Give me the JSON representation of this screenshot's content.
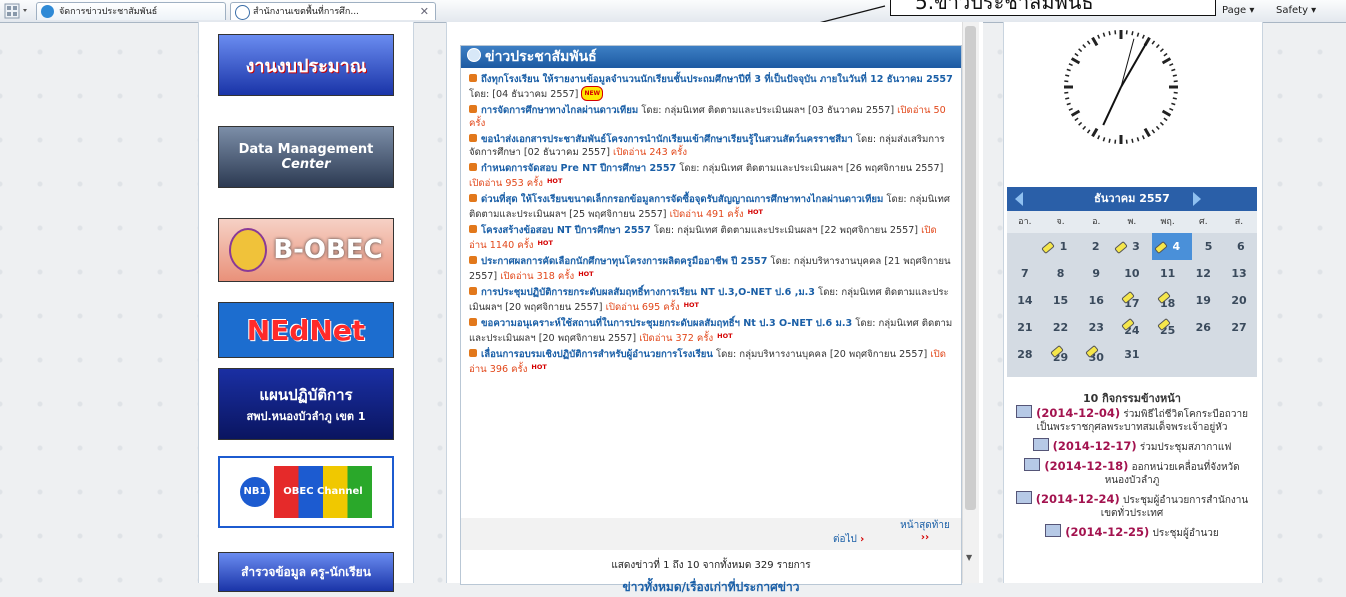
{
  "browser": {
    "tabs": [
      {
        "label": "จัดการข่าวประชาสัมพันธ์",
        "active": false
      },
      {
        "label": "สำนักงานเขตพื้นที่การศึก...",
        "active": true
      }
    ],
    "close_symbol": "✕",
    "commands": {
      "page": "Page ▾",
      "safety": "Safety ▾"
    },
    "icons": [
      "tab-grid-icon",
      "ie-icon",
      "close-icon"
    ]
  },
  "callout": {
    "text": "5.ข่าวประชาสัมพันธ์"
  },
  "left_banners": [
    {
      "label": "งานงบประมาณ"
    },
    {
      "label": "Data Management",
      "sub": "Center"
    },
    {
      "label": "B-OBEC"
    },
    {
      "label": "NEdNet"
    },
    {
      "label": "แผนปฏิบัติการ",
      "sub": "สพป.หนองบัวลำภู เขต 1"
    },
    {
      "label": "NB1",
      "sub": "OBEC Channel"
    },
    {
      "label": "สำรวจข้อมูล ครู-นักเรียน"
    }
  ],
  "news": {
    "header": "ข่าวประชาสัมพันธ์",
    "items": [
      {
        "title": "ถึงทุกโรงเรียน ให้รายงานข้อมูลจำนวนนักเรียนชั้นประถมศึกษาปีที่ 3 ที่เป็นปัจจุบัน ภายในวันที่ 12 ธันวาคม 2557",
        "meta": " โดย: [04 ธันวาคม 2557]",
        "read": "",
        "hot": "",
        "new": "NEW"
      },
      {
        "title": "การจัดการศึกษาทางไกลผ่านดาวเทียม",
        "meta": " โดย: กลุ่มนิเทศ ติดตามและประเมินผลฯ [03 ธันวาคม 2557] ",
        "read": "เปิดอ่าน 50 ครั้ง",
        "hot": "",
        "new": ""
      },
      {
        "title": "ขอนำส่งเอกสารประชาสัมพันธ์โครงการนำนักเรียนเข้าศึกษาเรียนรู้ในสวนสัตว์นครราชสีมา",
        "meta": " โดย: กลุ่มส่งเสริมการจัดการศึกษา [02 ธันวาคม 2557] ",
        "read": "เปิดอ่าน 243 ครั้ง",
        "hot": "",
        "new": ""
      },
      {
        "title": "กำหนดการจัดสอบ Pre NT ปีการศึกษา 2557",
        "meta": " โดย: กลุ่มนิเทศ ติดตามและประเมินผลฯ [26 พฤศจิกายน 2557] ",
        "read": "เปิดอ่าน 953 ครั้ง",
        "hot": "HOT",
        "new": ""
      },
      {
        "title": "ด่วนที่สุด ให้โรงเรียนขนาดเล็กกรอกข้อมูลการจัดซื้อจุดรับสัญญาณการศึกษาทางไกลผ่านดาวเทียม",
        "meta": " โดย: กลุ่มนิเทศ ติดตามและประเมินผลฯ [25 พฤศจิกายน 2557] ",
        "read": "เปิดอ่าน 491 ครั้ง",
        "hot": "HOT",
        "new": ""
      },
      {
        "title": "โครงสร้างข้อสอบ NT ปีการศึกษา 2557",
        "meta": " โดย: กลุ่มนิเทศ ติดตามและประเมินผลฯ [22 พฤศจิกายน 2557] ",
        "read": "เปิดอ่าน 1140 ครั้ง",
        "hot": "HOT",
        "new": ""
      },
      {
        "title": "ประกาศผลการคัดเลือกนักศึกษาทุนโครงการผลิตครูมืออาชีพ ปี 2557",
        "meta": " โดย: กลุ่มบริหารงานบุคคล [21 พฤศจิกายน 2557] ",
        "read": "เปิดอ่าน 318 ครั้ง",
        "hot": "HOT",
        "new": ""
      },
      {
        "title": "การประชุมปฏิบัติการยกระดับผลสัมฤทธิ์ทางการเรียน NT ป.3,O-NET ป.6 ,ม.3",
        "meta": " โดย: กลุ่มนิเทศ ติดตามและประเมินผลฯ [20 พฤศจิกายน 2557] ",
        "read": "เปิดอ่าน 695 ครั้ง",
        "hot": "HOT",
        "new": ""
      },
      {
        "title": "ขอความอนุเคราะห์ใช้สถานที่ในการประชุมยกระดับผลสัมฤทธิ์ฯ Nt ป.3 O-NET ป.6 ม.3",
        "meta": " โดย: กลุ่มนิเทศ ติดตามและประเมินผลฯ [20 พฤศจิกายน 2557] ",
        "read": "เปิดอ่าน 372 ครั้ง",
        "hot": "HOT",
        "new": ""
      },
      {
        "title": "เลื่อนการอบรมเชิงปฏิบัติการสำหรับผู้อำนวยการโรงเรียน",
        "meta": " โดย: กลุ่มบริหารงานบุคคล [20 พฤศจิกายน 2557] ",
        "read": "เปิดอ่าน 396 ครั้ง",
        "hot": "HOT",
        "new": ""
      }
    ],
    "pager": {
      "next": "ต่อไป",
      "next_arrow": "›",
      "last": "หน้าสุดท้าย",
      "last_arrow": "››"
    },
    "summary": "แสดงข่าวที่ 1 ถึง 10 จากทั้งหมด 329 รายการ",
    "all_link": "ข่าวทั้งหมด/เรื่องเก่าที่ประกาศข่าว"
  },
  "calendar": {
    "month": "ธันวาคม 2557",
    "dow": [
      "อา.",
      "จ.",
      "อ.",
      "พ.",
      "พฤ.",
      "ศ.",
      "ส."
    ],
    "weeks": [
      [
        "",
        "1",
        "2",
        "3",
        "4",
        "5",
        "6"
      ],
      [
        "7",
        "8",
        "9",
        "10",
        "11",
        "12",
        "13"
      ],
      [
        "14",
        "15",
        "16",
        "17",
        "18",
        "19",
        "20"
      ],
      [
        "21",
        "22",
        "23",
        "24",
        "25",
        "26",
        "27"
      ],
      [
        "28",
        "29",
        "30",
        "31",
        "",
        "",
        ""
      ]
    ],
    "event_days": [
      "1",
      "3",
      "4",
      "17",
      "18",
      "24",
      "25",
      "29",
      "30"
    ],
    "today": "4",
    "colors": {
      "header": "#2a5fa8",
      "today": "#4a90d9"
    }
  },
  "activities": {
    "title": "10 กิจกรรมข้างหน้า",
    "items": [
      {
        "date": "(2014-12-04)",
        "text": " ร่วมพิธีไถ่ชีวิตโคกระบือถวายเป็นพระราชกุศลพระบาทสมเด็จพระเจ้าอยู่หัว"
      },
      {
        "date": "(2014-12-17)",
        "text": " ร่วมประชุมสภากาแฟ"
      },
      {
        "date": "(2014-12-18)",
        "text": " ออกหน่วยเคลื่อนที่จังหวัดหนองบัวลำภู"
      },
      {
        "date": "(2014-12-24)",
        "text": " ประชุมผู้อำนวยการสำนักงานเขตทั่วประเทศ"
      },
      {
        "date": "(2014-12-25)",
        "text": " ประชุมผู้อำนวย"
      }
    ]
  }
}
